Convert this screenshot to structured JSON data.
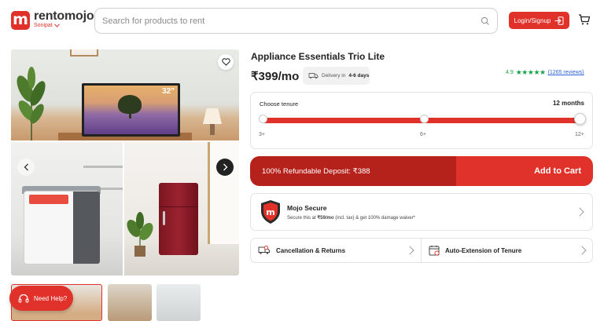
{
  "header": {
    "logo_letter": "m",
    "brand": "rentomojo",
    "city": "Sonipat",
    "search_placeholder": "Search for products to rent",
    "login_label": "Login/Signup"
  },
  "gallery": {
    "tv_badge": "32\""
  },
  "help": {
    "label": "Need Help?"
  },
  "product": {
    "title": "Appliance Essentials Trio Lite",
    "price": "₹399/mo",
    "delivery_prefix": "Delivery in",
    "delivery_days": "4-6 days",
    "rating": "4.9",
    "stars": "★★★★★",
    "reviews": "(1265 reviews)"
  },
  "tenure": {
    "label": "Choose tenure",
    "selected": "12 months",
    "ticks": [
      "3+",
      "6+",
      "12+"
    ],
    "selected_fraction": 1.0,
    "accent_color": "#e0312a"
  },
  "cta": {
    "deposit": "100% Refundable Deposit: ₹388",
    "add_to_cart": "Add to Cart"
  },
  "mojo": {
    "title": "Mojo Secure",
    "subtitle_pre": "Secure this at ",
    "subtitle_price": "₹59/mo",
    "subtitle_post": " (incl. tax) & get 100% damage waiver*"
  },
  "policies": {
    "cancellation": "Cancellation & Returns",
    "extension": "Auto-Extension of Tenure"
  }
}
